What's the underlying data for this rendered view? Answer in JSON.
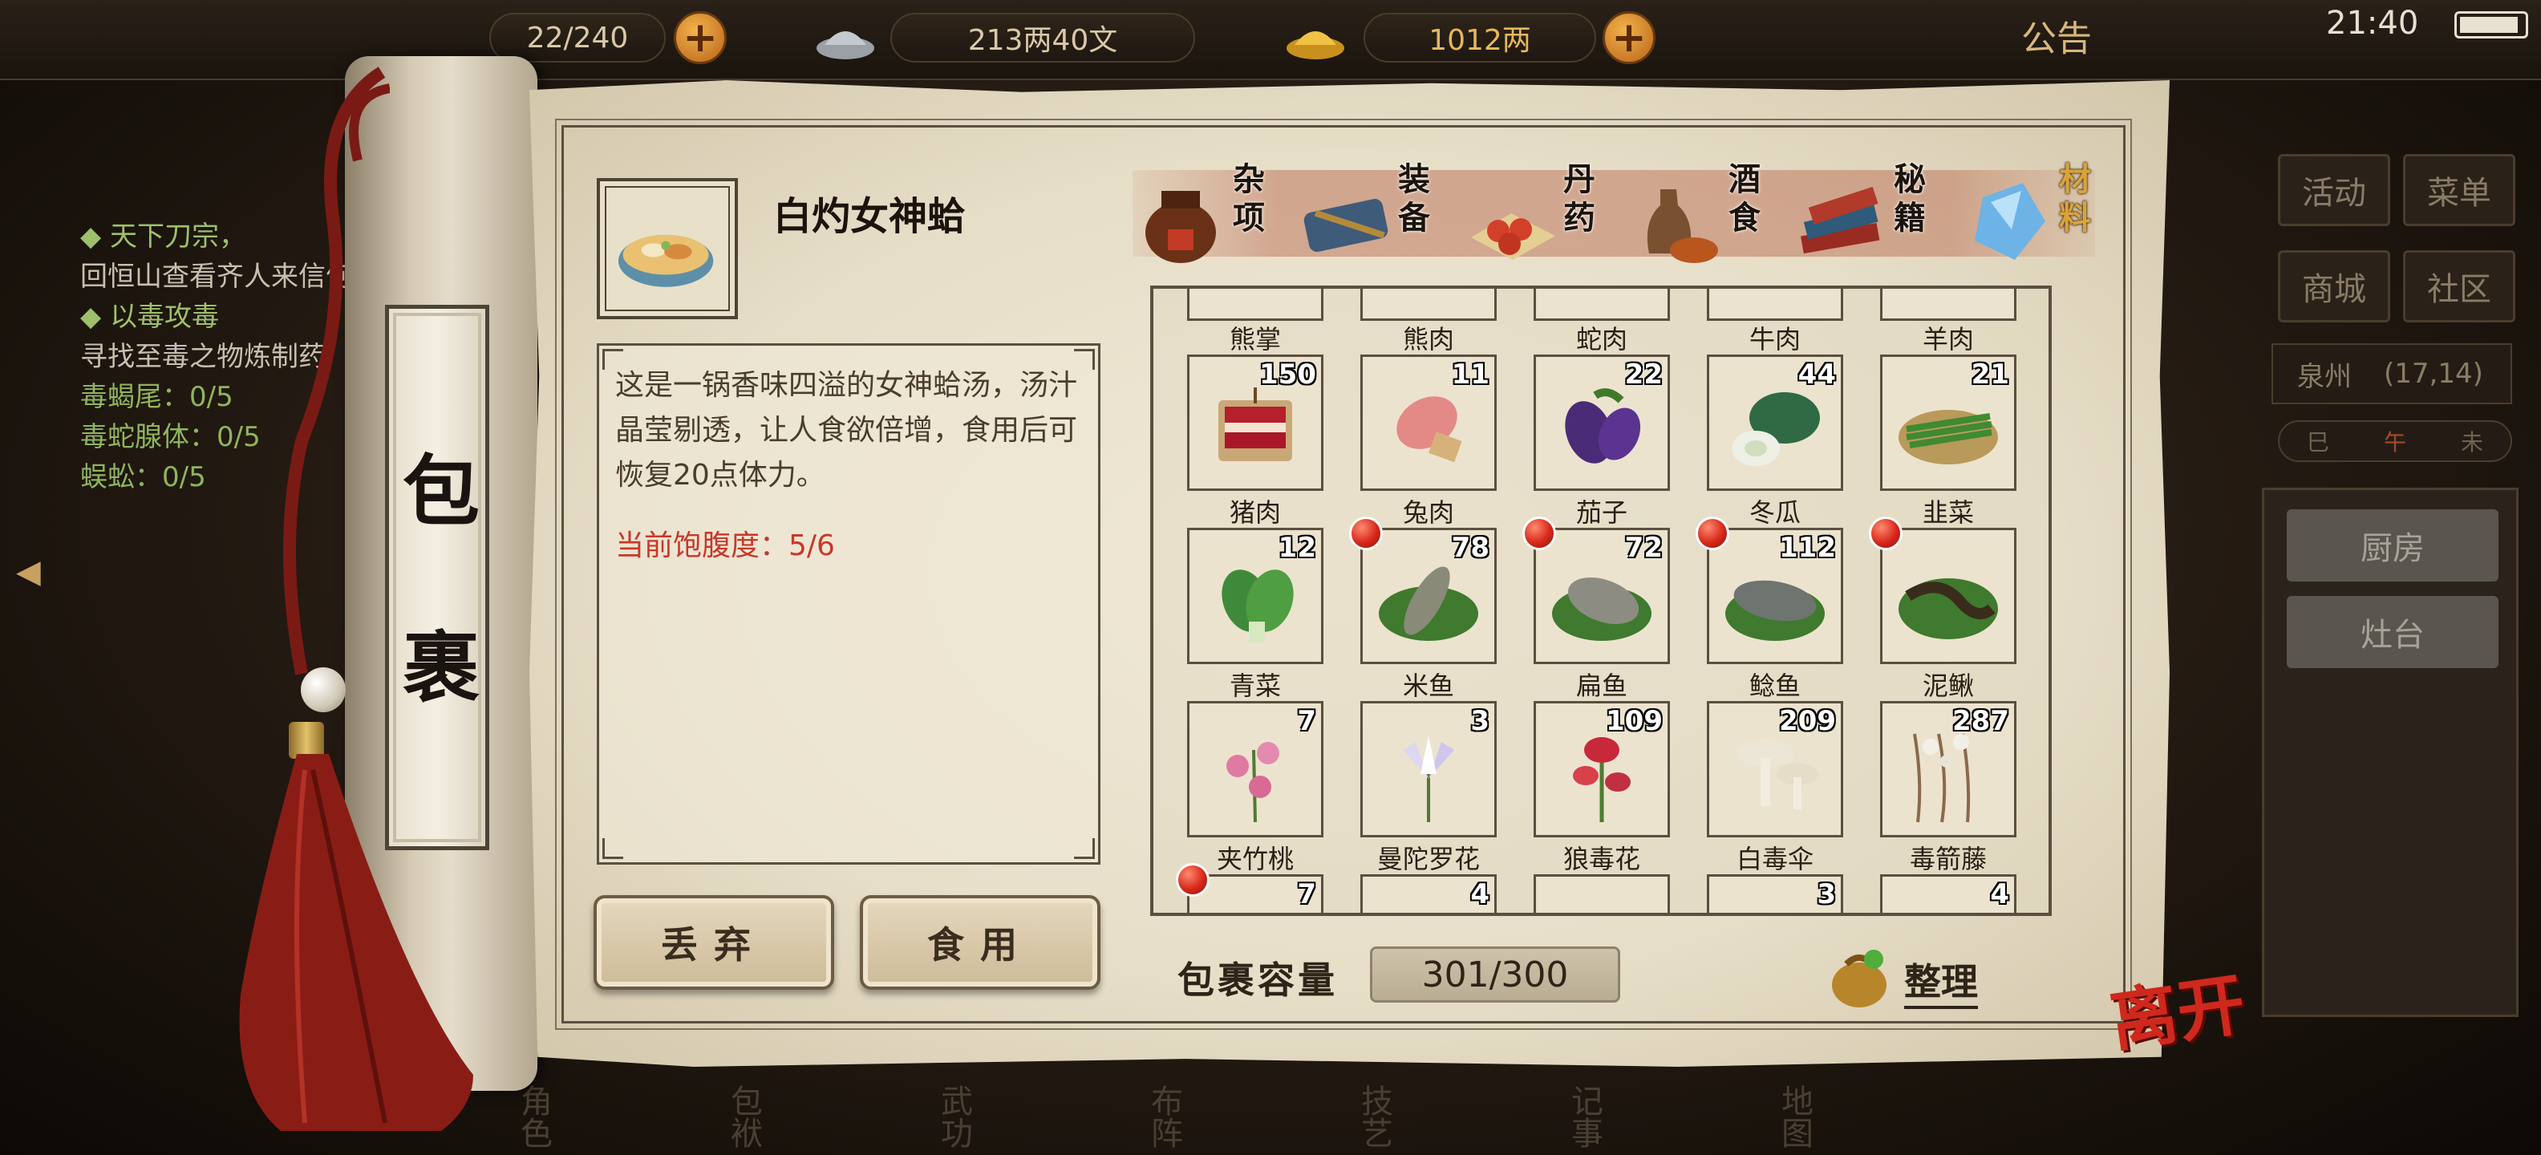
{
  "top_bar": {
    "stamina": "22/240",
    "money": "213两40文",
    "gold": "1012两",
    "notice_label": "公告",
    "time": "21:40"
  },
  "quests": [
    {
      "title": "天下刀宗，",
      "text": "回恒山查看齐人来信何事"
    },
    {
      "title": "以毒攻毒",
      "text": "寻找至毒之物炼制药"
    }
  ],
  "quest_progress": [
    {
      "name": "毒蝎尾",
      "value": "0/5"
    },
    {
      "name": "毒蛇腺体",
      "value": "0/5"
    },
    {
      "name": "蜈蚣",
      "value": "0/5"
    }
  ],
  "right_menu": {
    "activity": "活动",
    "menu": "菜单",
    "shop": "商城",
    "community": "社区",
    "location_name": "泉州",
    "location_coords": "(17,14)",
    "time_marks": [
      "巳",
      "午",
      "未"
    ],
    "kitchen": "厨房",
    "stove": "灶台"
  },
  "bottom_nav": [
    "角色",
    "包袱",
    "武功",
    "布阵",
    "技艺",
    "记事",
    "地图"
  ],
  "bag_title": [
    "包",
    "裹"
  ],
  "selected_item": {
    "name": "白灼女神蛤",
    "description": "这是一锅香味四溢的女神蛤汤，汤汁晶莹剔透，让人食欲倍增，食用后可恢复20点体力。",
    "satiety_label": "当前饱腹度：",
    "satiety_value": "5/6"
  },
  "actions": {
    "discard": "丢弃",
    "eat": "食用"
  },
  "categories": [
    {
      "label": "杂项",
      "icon": "jar-icon",
      "active": false
    },
    {
      "label": "装备",
      "icon": "equipment-icon",
      "active": false
    },
    {
      "label": "丹药",
      "icon": "pills-icon",
      "active": false
    },
    {
      "label": "酒食",
      "icon": "wine-food-icon",
      "active": false
    },
    {
      "label": "秘籍",
      "icon": "books-icon",
      "active": false
    },
    {
      "label": "材料",
      "icon": "crystal-icon",
      "active": true
    }
  ],
  "grid": {
    "partial_top_row": [
      "熊掌",
      "熊肉",
      "蛇肉",
      "牛肉",
      "羊肉"
    ],
    "rows": [
      [
        {
          "name": "猪肉",
          "count": "150",
          "icon": "pork-icon",
          "new": false
        },
        {
          "name": "兔肉",
          "count": "11",
          "icon": "rabbit-meat-icon",
          "new": false
        },
        {
          "name": "茄子",
          "count": "22",
          "icon": "eggplant-icon",
          "new": false
        },
        {
          "name": "冬瓜",
          "count": "44",
          "icon": "winter-melon-icon",
          "new": false
        },
        {
          "name": "韭菜",
          "count": "21",
          "icon": "chives-icon",
          "new": false
        }
      ],
      [
        {
          "name": "青菜",
          "count": "12",
          "icon": "greens-icon",
          "new": false
        },
        {
          "name": "米鱼",
          "count": "78",
          "icon": "fish-icon",
          "new": true
        },
        {
          "name": "扁鱼",
          "count": "72",
          "icon": "fish-icon",
          "new": true
        },
        {
          "name": "鲶鱼",
          "count": "112",
          "icon": "fish-icon",
          "new": true
        },
        {
          "name": "泥鳅",
          "count": "",
          "icon": "loach-icon",
          "new": true
        }
      ],
      [
        {
          "name": "夹竹桃",
          "count": "7",
          "icon": "flower-icon",
          "new": false
        },
        {
          "name": "曼陀罗花",
          "count": "3",
          "icon": "flower-icon",
          "new": false
        },
        {
          "name": "狼毒花",
          "count": "109",
          "icon": "flower-icon",
          "new": false
        },
        {
          "name": "白毒伞",
          "count": "209",
          "icon": "mushroom-icon",
          "new": false
        },
        {
          "name": "毒箭藤",
          "count": "287",
          "icon": "vine-icon",
          "new": false
        }
      ]
    ],
    "partial_bottom_row": [
      {
        "count": "7",
        "new": true
      },
      {
        "count": "4",
        "new": false
      },
      {
        "count": "",
        "new": false
      },
      {
        "count": "3",
        "new": false
      },
      {
        "count": "4",
        "new": false
      }
    ]
  },
  "capacity_label": "包裹容量",
  "capacity_value": "301/300",
  "sort_label": "整理",
  "leave_label": "离开",
  "colors": {
    "accent_red": "#c8382a",
    "active_tab": "#d9a43a",
    "paper": "#ece3cf"
  }
}
